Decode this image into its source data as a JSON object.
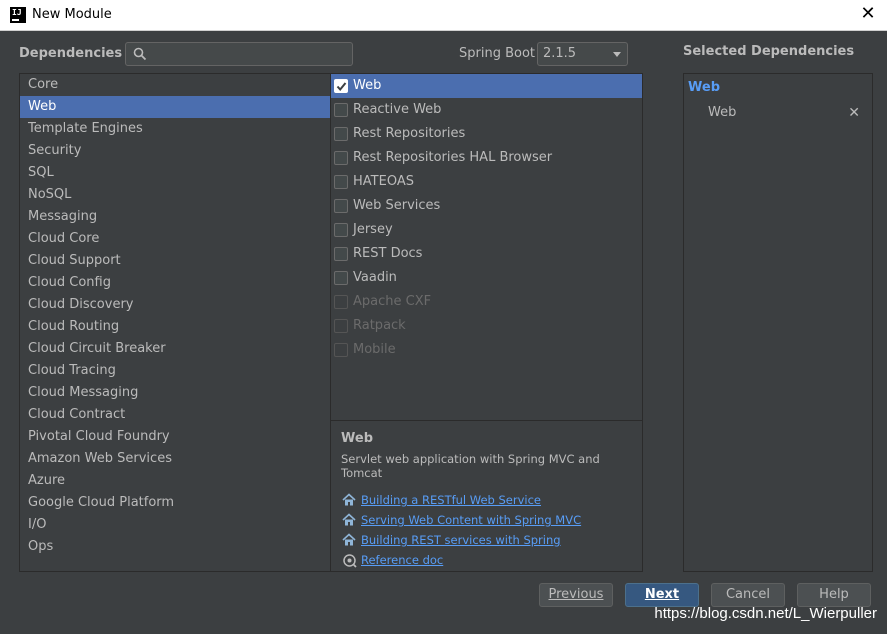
{
  "window": {
    "title": "New Module"
  },
  "header": {
    "dependencies_label": "Dependencies",
    "search_value": "",
    "spring_boot_label": "Spring Boot",
    "spring_boot_version": "2.1.5",
    "selected_dependencies_label": "Selected Dependencies"
  },
  "categories": [
    {
      "label": "Core",
      "selected": false
    },
    {
      "label": "Web",
      "selected": true
    },
    {
      "label": "Template Engines",
      "selected": false
    },
    {
      "label": "Security",
      "selected": false
    },
    {
      "label": "SQL",
      "selected": false
    },
    {
      "label": "NoSQL",
      "selected": false
    },
    {
      "label": "Messaging",
      "selected": false
    },
    {
      "label": "Cloud Core",
      "selected": false
    },
    {
      "label": "Cloud Support",
      "selected": false
    },
    {
      "label": "Cloud Config",
      "selected": false
    },
    {
      "label": "Cloud Discovery",
      "selected": false
    },
    {
      "label": "Cloud Routing",
      "selected": false
    },
    {
      "label": "Cloud Circuit Breaker",
      "selected": false
    },
    {
      "label": "Cloud Tracing",
      "selected": false
    },
    {
      "label": "Cloud Messaging",
      "selected": false
    },
    {
      "label": "Cloud Contract",
      "selected": false
    },
    {
      "label": "Pivotal Cloud Foundry",
      "selected": false
    },
    {
      "label": "Amazon Web Services",
      "selected": false
    },
    {
      "label": "Azure",
      "selected": false
    },
    {
      "label": "Google Cloud Platform",
      "selected": false
    },
    {
      "label": "I/O",
      "selected": false
    },
    {
      "label": "Ops",
      "selected": false
    }
  ],
  "dependencies": [
    {
      "label": "Web",
      "checked": true,
      "selected": true,
      "disabled": false
    },
    {
      "label": "Reactive Web",
      "checked": false,
      "selected": false,
      "disabled": false
    },
    {
      "label": "Rest Repositories",
      "checked": false,
      "selected": false,
      "disabled": false
    },
    {
      "label": "Rest Repositories HAL Browser",
      "checked": false,
      "selected": false,
      "disabled": false
    },
    {
      "label": "HATEOAS",
      "checked": false,
      "selected": false,
      "disabled": false
    },
    {
      "label": "Web Services",
      "checked": false,
      "selected": false,
      "disabled": false
    },
    {
      "label": "Jersey",
      "checked": false,
      "selected": false,
      "disabled": false
    },
    {
      "label": "REST Docs",
      "checked": false,
      "selected": false,
      "disabled": false
    },
    {
      "label": "Vaadin",
      "checked": false,
      "selected": false,
      "disabled": false
    },
    {
      "label": "Apache CXF",
      "checked": false,
      "selected": false,
      "disabled": true
    },
    {
      "label": "Ratpack",
      "checked": false,
      "selected": false,
      "disabled": true
    },
    {
      "label": "Mobile",
      "checked": false,
      "selected": false,
      "disabled": true
    }
  ],
  "description": {
    "title": "Web",
    "text": "Servlet web application with Spring MVC and Tomcat",
    "links": [
      {
        "label": "Building a RESTful Web Service",
        "icon": "home-icon"
      },
      {
        "label": "Serving Web Content with Spring MVC",
        "icon": "home-icon"
      },
      {
        "label": "Building REST services with Spring",
        "icon": "home-icon"
      },
      {
        "label": "Reference doc",
        "icon": "reference-doc-icon"
      }
    ]
  },
  "selected": {
    "group": "Web",
    "items": [
      {
        "label": "Web",
        "remove_glyph": "✕"
      }
    ]
  },
  "buttons": {
    "previous": "Previous",
    "next": "Next",
    "cancel": "Cancel",
    "help": "Help"
  },
  "watermark": "https://blog.csdn.net/L_Wierpuller",
  "colors": {
    "background": "#3c3f41",
    "selection": "#4b6eaf",
    "link": "#589df6",
    "default_button": "#365880"
  }
}
